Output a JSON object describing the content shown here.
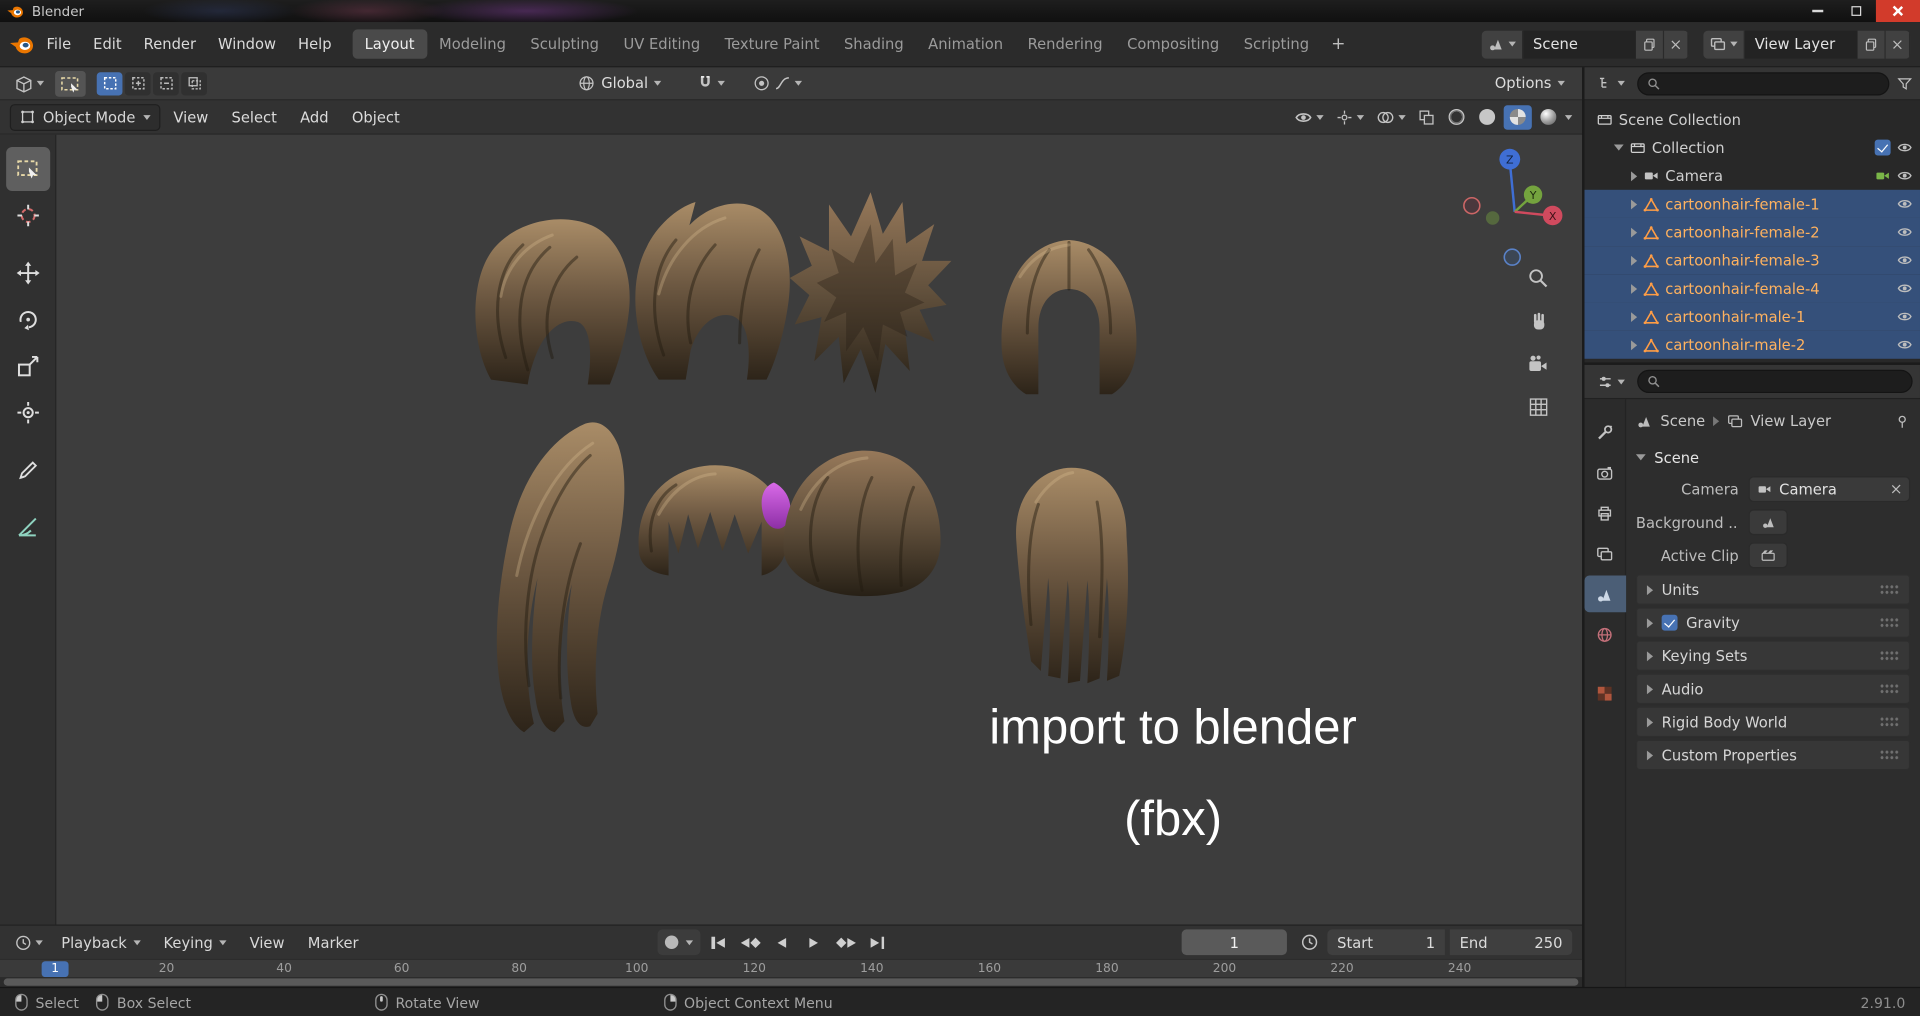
{
  "window": {
    "title": "Blender"
  },
  "topbar": {
    "menus": [
      "File",
      "Edit",
      "Render",
      "Window",
      "Help"
    ],
    "workspaces": [
      "Layout",
      "Modeling",
      "Sculpting",
      "UV Editing",
      "Texture Paint",
      "Shading",
      "Animation",
      "Rendering",
      "Compositing",
      "Scripting"
    ],
    "active_workspace": "Layout",
    "add_workspace_label": "+",
    "scene_field": "Scene",
    "view_layer_field": "View Layer"
  },
  "tool_settings": {
    "orientation": "Global",
    "options_label": "Options"
  },
  "viewport_header": {
    "mode": "Object Mode",
    "menus": [
      "View",
      "Select",
      "Add",
      "Object"
    ]
  },
  "viewport": {
    "caption_line1": "import to blender",
    "caption_line2": "(fbx)",
    "gizmo": {
      "x": "X",
      "y": "Y",
      "z": "Z"
    }
  },
  "outliner": {
    "items": [
      {
        "label": "Scene Collection",
        "selected": false
      },
      {
        "label": "Collection",
        "selected": false
      },
      {
        "label": "Camera",
        "selected": false
      },
      {
        "label": "cartoonhair-female-1",
        "selected": true
      },
      {
        "label": "cartoonhair-female-2",
        "selected": true
      },
      {
        "label": "cartoonhair-female-3",
        "selected": true
      },
      {
        "label": "cartoonhair-female-4",
        "selected": true
      },
      {
        "label": "cartoonhair-male-1",
        "selected": true
      },
      {
        "label": "cartoonhair-male-2",
        "selected": true
      }
    ]
  },
  "properties": {
    "breadcrumb": {
      "scene": "Scene",
      "view_layer": "View Layer"
    },
    "panel_scene_title": "Scene",
    "rows": {
      "camera_label": "Camera",
      "camera_value": "Camera",
      "background_label": "Background ...",
      "active_clip_label": "Active Clip"
    },
    "collapsed_panels": [
      "Units",
      "Gravity",
      "Keying Sets",
      "Audio",
      "Rigid Body World",
      "Custom Properties"
    ]
  },
  "timeline": {
    "menus": [
      "Playback",
      "Keying",
      "View",
      "Marker"
    ],
    "current_frame": "1",
    "start_label": "Start",
    "start_value": "1",
    "end_label": "End",
    "end_value": "250",
    "playhead_frame": "1",
    "ruler_ticks": [
      "20",
      "40",
      "60",
      "80",
      "100",
      "120",
      "140",
      "160",
      "180",
      "200",
      "220",
      "240"
    ]
  },
  "statusbar": {
    "hints": [
      {
        "label": "Select"
      },
      {
        "label": "Box Select"
      },
      {
        "label": "Rotate View"
      },
      {
        "label": "Object Context Menu"
      }
    ],
    "version": "2.91.0"
  },
  "colors": {
    "accent": "#4772b3",
    "selection_row": "#35507a",
    "selected_object_text": "#ffb25f",
    "mesh_icon_orange": "#ff9d45",
    "viewport_bg": "#3d3d3d",
    "hair_base": "#8a7458",
    "hair_magenta": "#c050d8"
  }
}
